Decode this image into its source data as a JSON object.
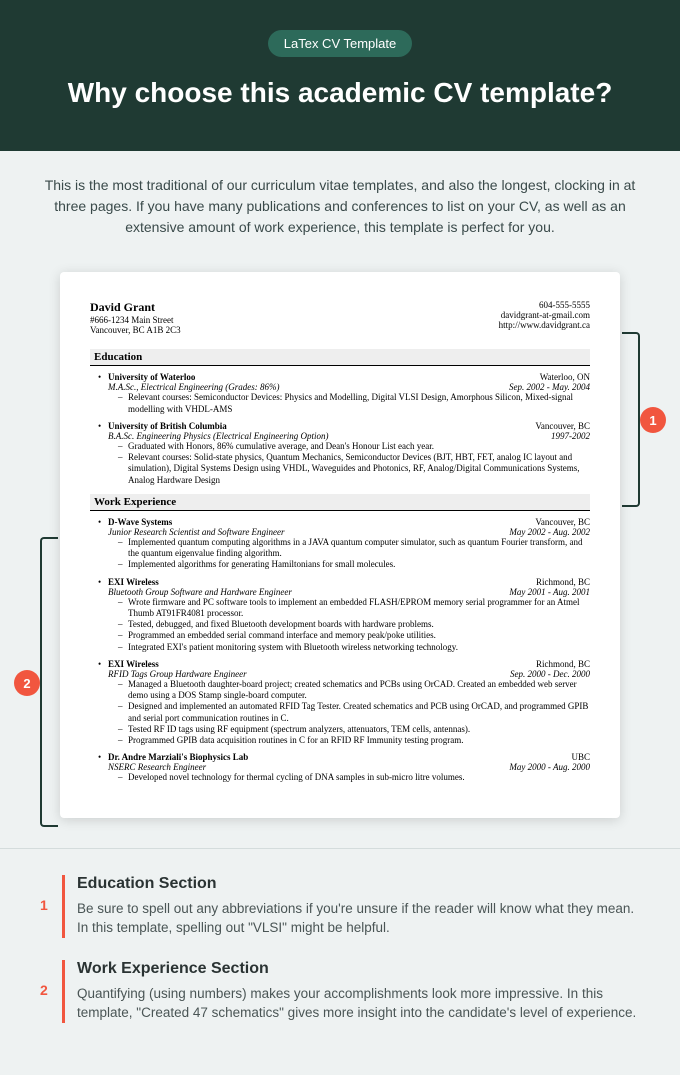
{
  "header": {
    "badge": "LaTex CV Template",
    "title": "Why choose this academic CV template?"
  },
  "intro": "This is the most traditional of our curriculum vitae templates, and also the longest, clocking in at three pages. If you have many publications and conferences to list on your CV, as well as an extensive amount of work experience, this template is perfect for you.",
  "cv": {
    "name": "David Grant",
    "addr1": "#666-1234 Main Street",
    "addr2": "Vancouver, BC A1B 2C3",
    "phone": "604-555-5555",
    "email": "davidgrant-at-gmail.com",
    "web": "http://www.davidgrant.ca",
    "sec_edu": "Education",
    "edu": [
      {
        "school": "University of Waterloo",
        "loc": "Waterloo, ON",
        "degree": "M.A.Sc., Electrical Engineering (Grades: 86%)",
        "dates": "Sep. 2002 - May. 2004",
        "bullets": [
          "Relevant courses: Semiconductor Devices: Physics and Modelling, Digital VLSI Design, Amorphous Silicon, Mixed-signal modelling with VHDL-AMS"
        ]
      },
      {
        "school": "University of British Columbia",
        "loc": "Vancouver, BC",
        "degree": "B.A.Sc. Engineering Physics (Electrical Engineering Option)",
        "dates": "1997-2002",
        "bullets": [
          "Graduated with Honors, 86% cumulative average, and Dean's Honour List each year.",
          "Relevant courses: Solid-state physics, Quantum Mechanics, Semiconductor Devices (BJT, HBT, FET, analog IC layout and simulation), Digital Systems Design using VHDL, Waveguides and Photonics, RF, Analog/Digital Communications Systems, Analog Hardware Design"
        ]
      }
    ],
    "sec_work": "Work Experience",
    "work": [
      {
        "company": "D-Wave Systems",
        "loc": "Vancouver, BC",
        "role": "Junior Research Scientist and Software Engineer",
        "dates": "May 2002 - Aug. 2002",
        "bullets": [
          "Implemented quantum computing algorithms in a JAVA quantum computer simulator, such as quantum Fourier transform, and the quantum eigenvalue finding algorithm.",
          "Implemented algorithms for generating Hamiltonians for small molecules."
        ]
      },
      {
        "company": "EXI Wireless",
        "loc": "Richmond, BC",
        "role": "Bluetooth Group Software and Hardware Engineer",
        "dates": "May 2001 - Aug. 2001",
        "bullets": [
          "Wrote firmware and PC software tools to implement an embedded FLASH/EPROM memory serial programmer for an Atmel Thumb AT91FR4081 processor.",
          "Tested, debugged, and fixed Bluetooth development boards with hardware problems.",
          "Programmed an embedded serial command interface and memory peak/poke utilities.",
          "Integrated EXI's patient monitoring system with Bluetooth wireless networking technology."
        ]
      },
      {
        "company": "EXI Wireless",
        "loc": "Richmond, BC",
        "role": "RFID Tags Group Hardware Engineer",
        "dates": "Sep. 2000 - Dec. 2000",
        "bullets": [
          "Managed a Bluetooth daughter-board project; created schematics and PCBs using OrCAD. Created an embedded web server demo using a DOS Stamp single-board computer.",
          "Designed and implemented an automated RFID Tag Tester. Created schematics and PCB using OrCAD, and programmed GPIB and serial port communication routines in C.",
          "Tested RF ID tags using RF equipment (spectrum analyzers, attenuators, TEM cells, antennas).",
          "Programmed GPIB data acquisition routines in C for an RFID RF Immunity testing program."
        ]
      },
      {
        "company": "Dr. Andre Marziali's Biophysics Lab",
        "loc": "UBC",
        "role": "NSERC Research Engineer",
        "dates": "May 2000 - Aug. 2000",
        "bullets": [
          "Developed novel technology for thermal cycling of DNA samples in sub-micro litre volumes."
        ]
      }
    ]
  },
  "markers": {
    "m1": "1",
    "m2": "2"
  },
  "notes": [
    {
      "num": "1",
      "title": "Education Section",
      "text": "Be sure to spell out any abbreviations if you're unsure if the reader will know what they mean. In this template, spelling out \"VLSI\" might be helpful."
    },
    {
      "num": "2",
      "title": "Work Experience Section",
      "text": "Quantifying (using numbers) makes your accomplishments look more impressive. In this template, \"Created 47 schematics\" gives more insight into the candidate's level of experience."
    }
  ]
}
